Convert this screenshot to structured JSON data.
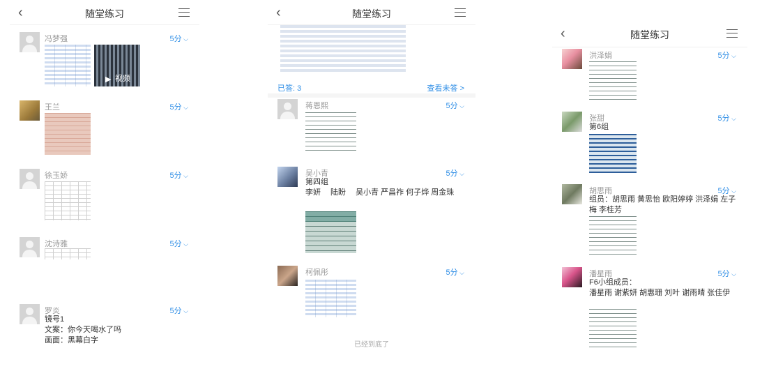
{
  "title": "随堂练习",
  "score_label": "5分",
  "panel1": {
    "items": [
      {
        "name": "冯梦强",
        "video_label": "视频"
      },
      {
        "name": "王兰"
      },
      {
        "name": "徐玉娇"
      },
      {
        "name": "沈诗雅"
      },
      {
        "name": "罗炎",
        "lines": [
          "镜号1",
          "文案：你今天喝水了吗",
          "画面：黑幕白字"
        ]
      }
    ]
  },
  "panel2": {
    "answered": "已答: 3",
    "view_unanswered": "查看未答 >",
    "items": [
      {
        "name": "蒋恩熙"
      },
      {
        "name": "吴小青",
        "lines": [
          "第四组",
          "李妍　 陆盼　 吴小青  严昌祚  何子烨  周金珠"
        ]
      },
      {
        "name": "柯佩彤"
      }
    ],
    "footer": "已经到底了"
  },
  "panel3": {
    "items": [
      {
        "name": "洪泽娟"
      },
      {
        "name": "张甜",
        "lines": [
          "第6组"
        ]
      },
      {
        "name": "胡思雨",
        "lines": [
          "组员：胡思雨  黄思怡  欧阳婷婷  洪泽娟  左子梅  李桂芳"
        ]
      },
      {
        "name": "潘星雨",
        "lines": [
          "F6小组成员：",
          "潘星雨  谢紫妍  胡惠珊  刘叶  谢雨晴  张佳伊"
        ]
      }
    ]
  }
}
